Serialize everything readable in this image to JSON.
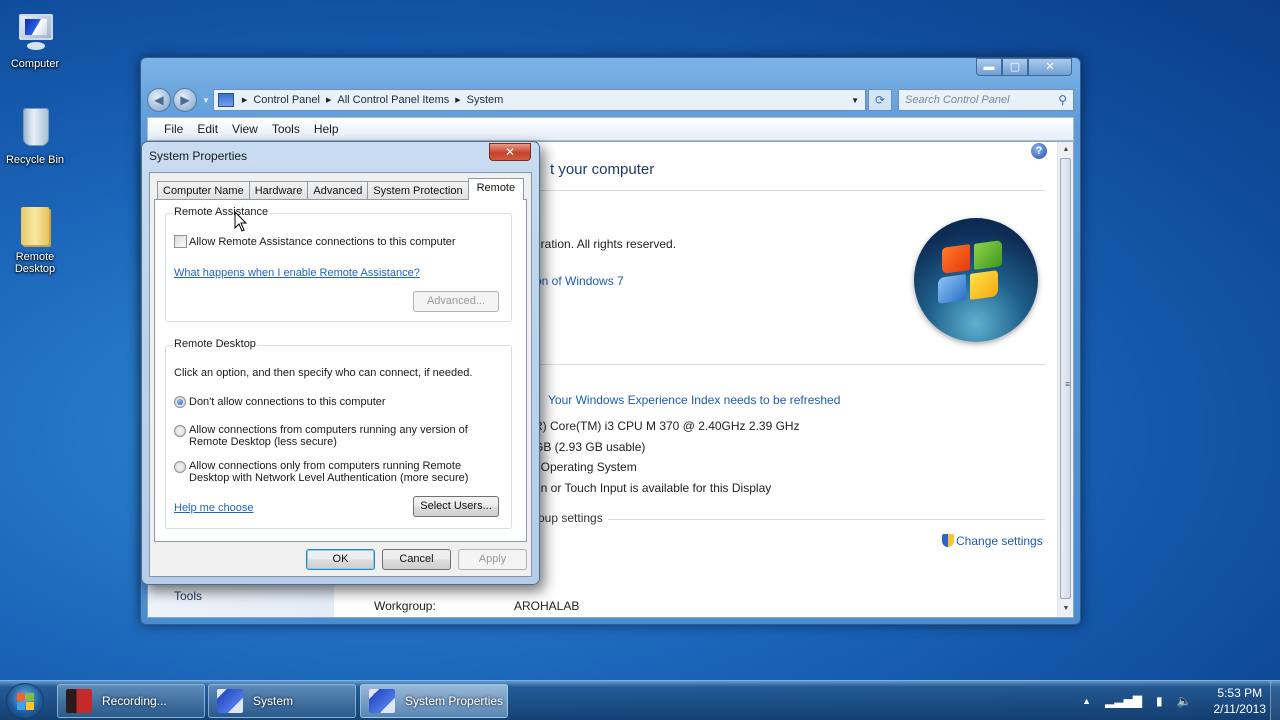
{
  "desktop": {
    "icons": [
      {
        "label": "Computer",
        "icon": "computer-icon"
      },
      {
        "label": "Recycle Bin",
        "icon": "recycle-bin-icon"
      },
      {
        "label": "Remote Desktop",
        "icon": "folder-icon"
      }
    ]
  },
  "explorer": {
    "window_controls": {
      "minimize": "▬",
      "maximize": "▢",
      "close": "✕"
    },
    "breadcrumb": [
      "Control Panel",
      "All Control Panel Items",
      "System"
    ],
    "search_placeholder": "Search Control Panel",
    "menu": [
      "File",
      "Edit",
      "View",
      "Tools",
      "Help"
    ],
    "left_pane": {
      "tools_label": "Tools"
    },
    "heading_partial": "t your computer",
    "copyright_partial": "oration.  All rights reserved.",
    "edition_link_partial": "on of Windows 7",
    "wei_link": "Your Windows Experience Index needs to be refreshed",
    "processor_partial": "R) Core(TM) i3 CPU       M 370  @ 2.40GHz   2.39 GHz",
    "memory_partial": "GB (2.93 GB usable)",
    "system_type_partial": "t Operating System",
    "pen_touch_partial": "en or Touch Input is available for this Display",
    "section_partial": "roup settings",
    "change_settings": "Change settings",
    "workgroup_label": "Workgroup:",
    "workgroup_value": "AROHALAB",
    "help_glyph": "?"
  },
  "dialog": {
    "title": "System Properties",
    "close_glyph": "✕",
    "tabs": [
      {
        "label": "Computer Name",
        "active": false
      },
      {
        "label": "Hardware",
        "active": false
      },
      {
        "label": "Advanced",
        "active": false
      },
      {
        "label": "System Protection",
        "active": false
      },
      {
        "label": "Remote",
        "active": true
      }
    ],
    "remote_assistance": {
      "group_label": "Remote Assistance",
      "checkbox_label": "Allow Remote Assistance connections to this computer",
      "checked": false,
      "help_link": "What happens when I enable Remote Assistance?",
      "advanced_button": "Advanced..."
    },
    "remote_desktop": {
      "group_label": "Remote Desktop",
      "instruction": "Click an option, and then specify who can connect, if needed.",
      "options": [
        {
          "line1": "Don't allow connections to this computer",
          "line2": "",
          "selected": true
        },
        {
          "line1": "Allow connections from computers running any version of",
          "line2": "Remote Desktop (less secure)",
          "selected": false
        },
        {
          "line1": "Allow connections only from computers running Remote",
          "line2": "Desktop with Network Level Authentication (more secure)",
          "selected": false
        }
      ],
      "help_link": "Help me choose",
      "select_users_button": "Select Users..."
    },
    "buttons": {
      "ok": "OK",
      "cancel": "Cancel",
      "apply": "Apply"
    }
  },
  "taskbar": {
    "items": [
      {
        "label": "Recording...",
        "icon": "recorder-icon",
        "active": false
      },
      {
        "label": "System",
        "icon": "system-icon",
        "active": false
      },
      {
        "label": "System Properties",
        "icon": "system-icon",
        "active": true
      }
    ],
    "tray": {
      "show_hidden": "▲",
      "time": "5:53 PM",
      "date": "2/11/2013"
    }
  }
}
